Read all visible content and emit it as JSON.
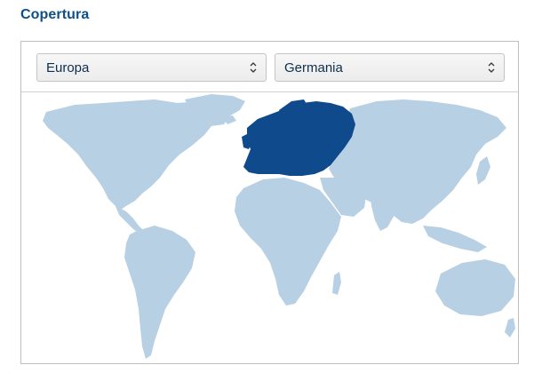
{
  "section": {
    "title": "Copertura"
  },
  "filters": {
    "region": {
      "value": "Europa"
    },
    "country": {
      "value": "Germania"
    }
  },
  "map": {
    "highlighted_region": "Europa",
    "colors": {
      "land": "#b8d0e3",
      "highlight": "#0e4a8c",
      "background": "#ffffff"
    }
  },
  "icons": {
    "select_arrow": "chevron-up-down-icon"
  }
}
